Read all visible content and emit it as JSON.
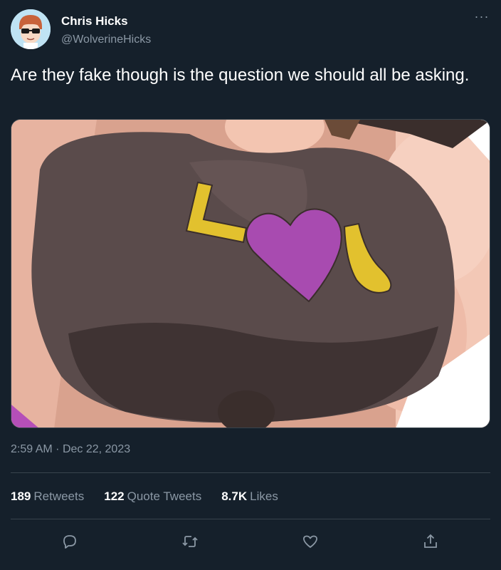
{
  "user": {
    "display_name": "Chris Hicks",
    "handle": "@WolverineHicks",
    "avatar_icon": "cartoon-face-with-sunglasses"
  },
  "menu": {
    "more_icon": "more-horizontal-icon",
    "more_glyph": "···"
  },
  "tweet": {
    "text": "Are they fake though is the question we should all be asking.",
    "media_description_icon": "illustration-image",
    "media_shirt_text": "LOU",
    "time": "2:59 AM",
    "separator": "·",
    "date": "Dec 22, 2023"
  },
  "stats": {
    "retweets": {
      "count": "189",
      "label": "Retweets"
    },
    "quotes": {
      "count": "122",
      "label": "Quote Tweets"
    },
    "likes": {
      "count": "8.7K",
      "label": "Likes"
    }
  },
  "actions": {
    "reply": "reply-icon",
    "retweet": "retweet-icon",
    "like": "heart-icon",
    "share": "share-icon"
  },
  "colors": {
    "background": "#15202b",
    "text": "#ffffff",
    "secondary": "#8b98a5",
    "border": "#38444d"
  }
}
